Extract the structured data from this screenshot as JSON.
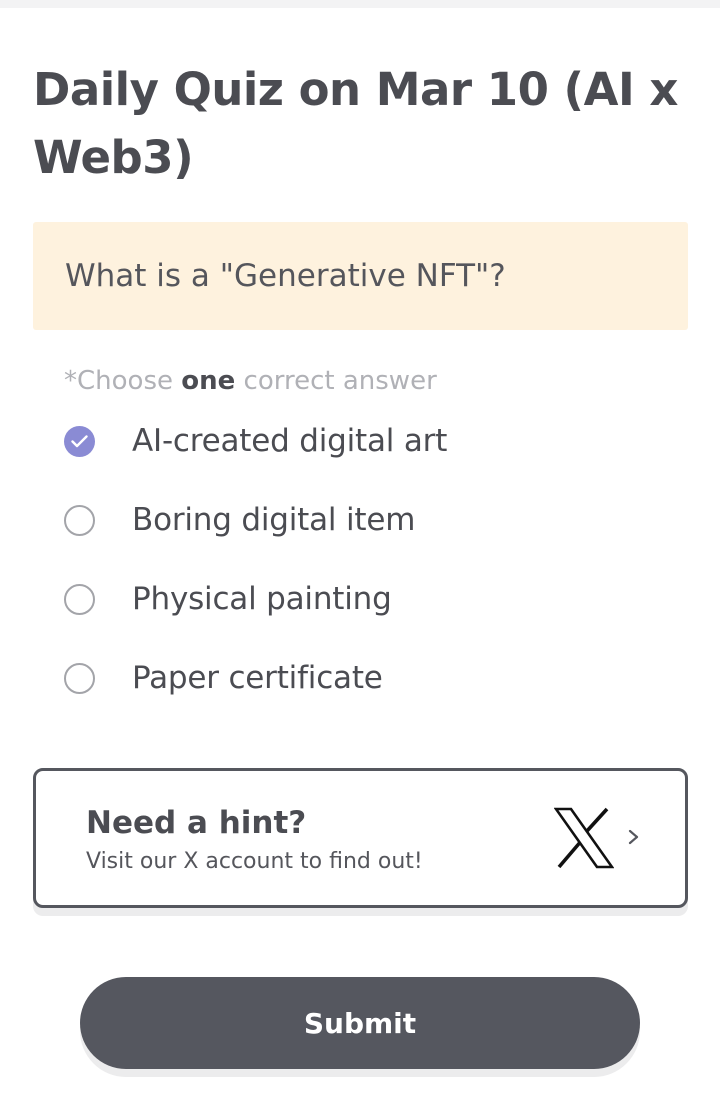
{
  "quiz": {
    "title": "Daily Quiz on Mar 10 (AI x Web3)",
    "question": "What is a \"Generative NFT\"?",
    "instruction": {
      "prefix": "*Choose ",
      "emphasis": "one",
      "suffix": " correct answer"
    },
    "options": [
      {
        "label": "AI-created digital art",
        "selected": true
      },
      {
        "label": "Boring digital item",
        "selected": false
      },
      {
        "label": "Physical painting",
        "selected": false
      },
      {
        "label": "Paper certificate",
        "selected": false
      }
    ]
  },
  "hint": {
    "title": "Need a hint?",
    "subtitle": "Visit our X account to find out!",
    "icon": "x-logo-icon",
    "arrow_icon": "chevron-right-icon"
  },
  "submit_label": "Submit",
  "colors": {
    "selected_radio": "#8a8bd4",
    "question_background": "#fef2de",
    "button_background": "#55575f",
    "text_primary": "#4b4c52",
    "text_muted": "#b0b1b6"
  }
}
